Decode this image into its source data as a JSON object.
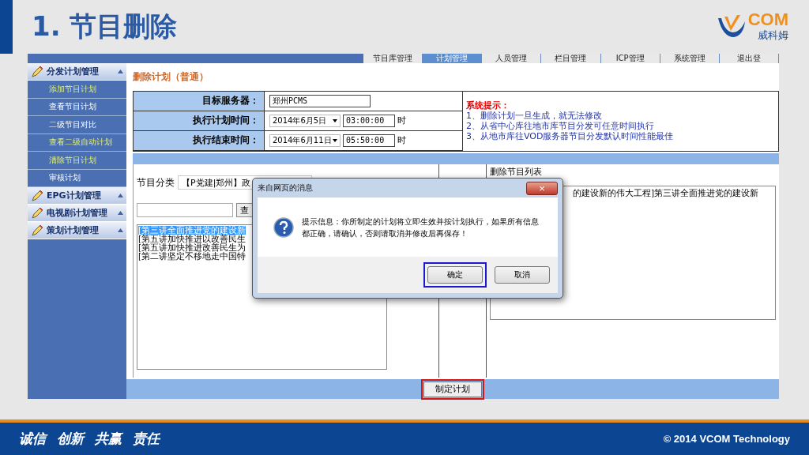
{
  "slide": {
    "title": "1. 节目删除",
    "logo": {
      "mark": "COM",
      "name": "威科姆"
    }
  },
  "nav_tabs": [
    {
      "label": "节目库管理",
      "selected": false
    },
    {
      "label": "计划管理",
      "selected": true
    },
    {
      "label": "人员管理",
      "selected": false
    },
    {
      "label": "栏目管理",
      "selected": false
    },
    {
      "label": "ICP管理",
      "selected": false
    },
    {
      "label": "系统管理",
      "selected": false
    },
    {
      "label": "退出登",
      "selected": false
    }
  ],
  "sidebar": [
    {
      "title": "分发计划管理",
      "items": [
        {
          "label": "添加节目计划",
          "highlighted": true
        },
        {
          "label": "查看节目计划",
          "highlighted": false
        },
        {
          "label": "二级节目对比",
          "highlighted": false
        },
        {
          "label": "查看二级自动计划",
          "highlighted": true
        },
        {
          "label": "清除节目计划",
          "highlighted": true
        },
        {
          "label": "审核计划",
          "highlighted": false
        }
      ]
    },
    {
      "title": "EPG计划管理"
    },
    {
      "title": "电视剧计划管理"
    },
    {
      "title": "策划计划管理"
    }
  ],
  "page_title": "删除计划（普通）",
  "form": [
    {
      "label": "目标服务器：",
      "kind": "text",
      "value": "郑州PCMS"
    },
    {
      "label": "执行计划时间：",
      "kind": "datetime",
      "date": "2014年6月5日",
      "time": "03:00:00",
      "unit": "时"
    },
    {
      "label": "执行结束时间：",
      "kind": "datetime",
      "date": "2014年6月11日",
      "time": "05:50:00",
      "unit": "时"
    }
  ],
  "system_hint": {
    "title": "系统提示：",
    "lines": [
      "1、删除计划一旦生成，就无法修改",
      "2、从省中心库往地市库节目分发可任意时间执行",
      "3、从地市库往VOD服务器节目分发默认时间性能最佳"
    ]
  },
  "category": {
    "label": "节目分类",
    "value": "【P党建|郑州】政",
    "search_button": "查"
  },
  "program_list": [
    {
      "label": "[第三讲全面推进党的建设新",
      "selected": true
    },
    {
      "label": "[第五讲加快推进以改善民生",
      "selected": false
    },
    {
      "label": "[第五讲加快推进改善民生为",
      "selected": false
    },
    {
      "label": "[第二讲坚定不移地走中国特",
      "selected": false
    }
  ],
  "delete_list": {
    "title": "删除节目列表",
    "items": [
      "的建设新的伟大工程]第三讲全面推进党的建设新"
    ]
  },
  "submit_button": {
    "label": "制定计划",
    "highlighted": true
  },
  "dialog": {
    "title": "来自网页的消息",
    "close": "×",
    "message": "提示信息：你所制定的计划将立即生效并按计划执行，如果所有信息都正确，请确认，否则请取消并修改后再保存！",
    "buttons": [
      {
        "label": "确定",
        "highlighted": true
      },
      {
        "label": "取消",
        "highlighted": false
      }
    ]
  },
  "footer": {
    "slogans": [
      "诚信",
      "创新",
      "共赢",
      "责任"
    ],
    "copyright": "© 2014 VCOM Technology"
  }
}
